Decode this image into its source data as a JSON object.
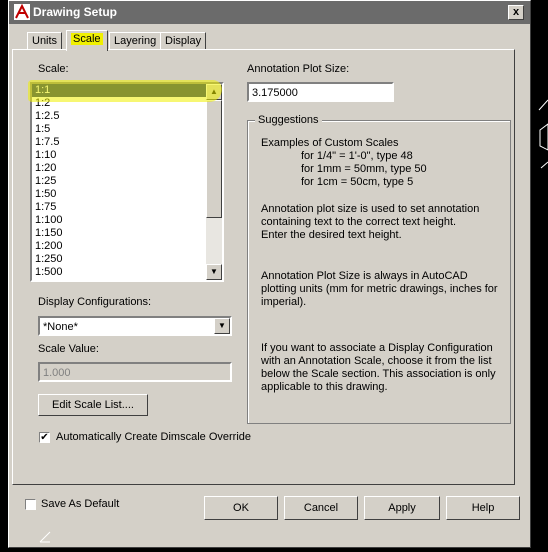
{
  "window": {
    "title": "Drawing Setup",
    "close_glyph": "x"
  },
  "tabs": [
    {
      "label": "Units"
    },
    {
      "label": "Scale"
    },
    {
      "label": "Layering"
    },
    {
      "label": "Display"
    }
  ],
  "scale": {
    "label": "Scale:",
    "items": [
      "1:1",
      "1:2",
      "1:2.5",
      "1:5",
      "1:7.5",
      "1:10",
      "1:20",
      "1:25",
      "1:50",
      "1:75",
      "1:100",
      "1:150",
      "1:200",
      "1:250",
      "1:500"
    ],
    "selected": "1:1"
  },
  "display_config": {
    "label": "Display Configurations:",
    "value": "*None*"
  },
  "scale_value": {
    "label": "Scale Value:",
    "value": "1.000"
  },
  "edit_scale_list_label": "Edit Scale List....",
  "dimscale": {
    "label": "Automatically Create Dimscale Override",
    "checked": true
  },
  "annotation": {
    "label": "Annotation Plot Size:",
    "value": "3.175000"
  },
  "suggestions": {
    "title": "Suggestions",
    "examples_heading": "Examples of Custom Scales",
    "examples": [
      "for 1/4\" = 1'-0\", type 48",
      "for 1mm = 50mm, type 50",
      "for 1cm = 50cm, type 5"
    ],
    "para1": "Annotation plot size is used to set annotation\ncontaining text to the correct text height.\nEnter the desired text height.",
    "para2": "Annotation Plot Size is always in AutoCAD\nplotting units (mm for metric drawings, inches for\nimperial).",
    "para3": "If you want to associate a Display Configuration\nwith an Annotation Scale, choose it from the list\nbelow the Scale section.  This association is only\napplicable to this drawing."
  },
  "save_as_default": {
    "label": "Save As Default",
    "checked": false
  },
  "buttons": {
    "ok": "OK",
    "cancel": "Cancel",
    "apply": "Apply",
    "help": "Help"
  },
  "colors": {
    "title_bar": "#6b6b6b",
    "dialog_bg": "#d4d0c8",
    "selection": "#0a246a",
    "marker_highlight": "#f0f000"
  }
}
